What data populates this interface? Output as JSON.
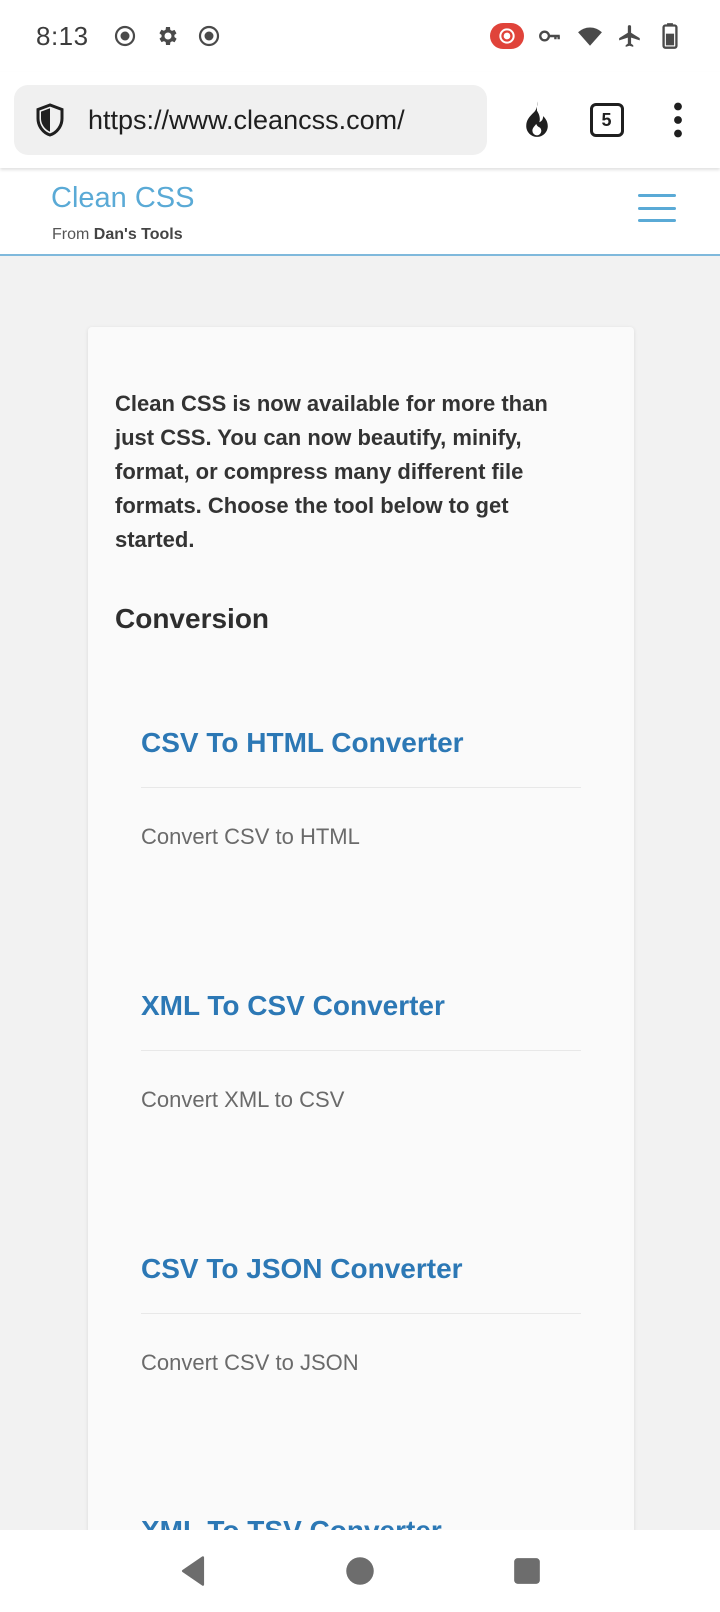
{
  "status_bar": {
    "time": "8:13",
    "left_icons": [
      "record-icon",
      "gear-icon",
      "record-icon"
    ],
    "right_icons": [
      "screen-record-icon",
      "vpn-key-icon",
      "wifi-icon",
      "airplane-icon",
      "battery-icon"
    ],
    "record_badge_color": "#e0433a"
  },
  "browser": {
    "url": "https://www.cleancss.com/",
    "tab_count": "5",
    "icons": [
      "shield-icon",
      "fire-icon",
      "more-icon"
    ]
  },
  "site": {
    "title": "Clean CSS",
    "subtitle_prefix": "From ",
    "subtitle_brand": "Dan's Tools",
    "accent_color": "#5aaad6"
  },
  "content": {
    "intro": "Clean CSS is now available for more than just CSS. You can now beautify, minify, format, or compress many different file formats. Choose the tool below to get started.",
    "section_heading": "Conversion",
    "tools": [
      {
        "title": "CSV To HTML Converter",
        "description": "Convert CSV to HTML"
      },
      {
        "title": "XML To CSV Converter",
        "description": "Convert XML to CSV"
      },
      {
        "title": "CSV To JSON Converter",
        "description": "Convert CSV to JSON"
      },
      {
        "title": "XML To TSV Converter",
        "description": ""
      }
    ],
    "link_color": "#2c78b5"
  },
  "nav": {
    "icons": [
      "back-icon",
      "home-icon",
      "recents-icon"
    ]
  }
}
